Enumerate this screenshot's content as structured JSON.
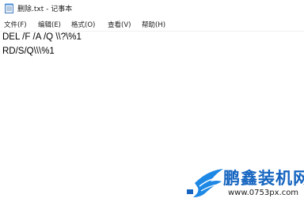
{
  "window": {
    "title": "删除.txt - 记事本",
    "icon": "notepad-icon"
  },
  "menu": [
    {
      "label": "文件(F)"
    },
    {
      "label": "编辑(E)"
    },
    {
      "label": "格式(O)"
    },
    {
      "label": "查看(V)"
    },
    {
      "label": "帮助(H)"
    }
  ],
  "document": {
    "lines": [
      "DEL /F /A /Q \\\\?\\%1",
      "RD/S/Q\\\\\\%1"
    ]
  },
  "watermark": {
    "name": "鹏鑫装机网",
    "url": "www.0753px.com",
    "brand_color": "#1565c0",
    "logo": "bird-logo"
  }
}
